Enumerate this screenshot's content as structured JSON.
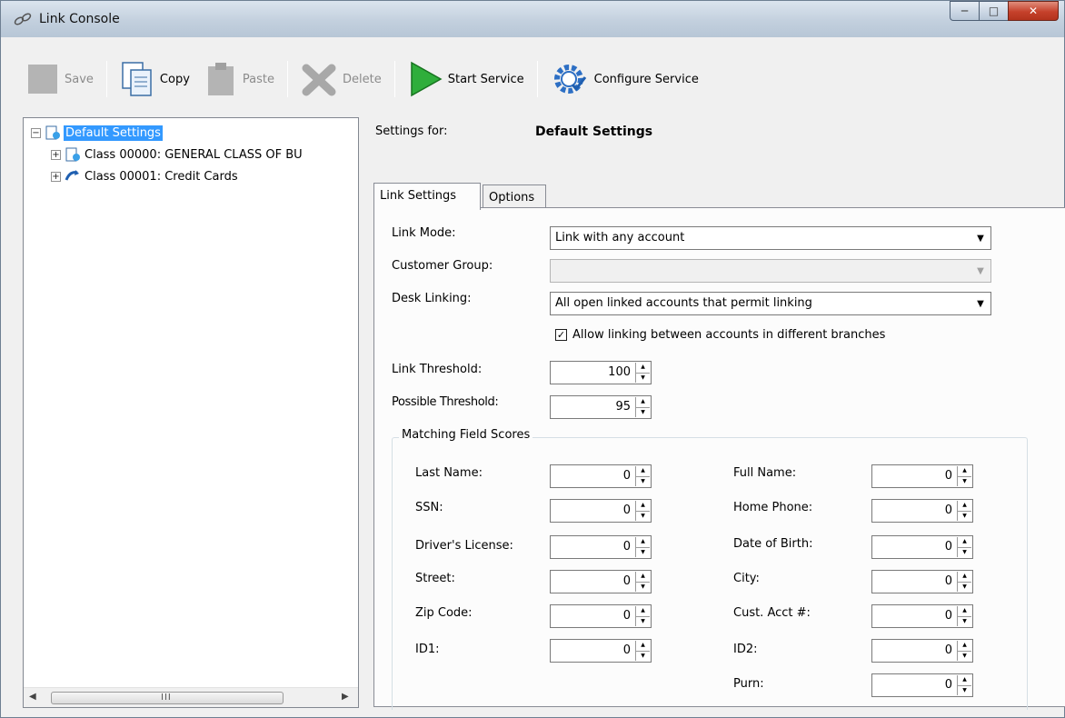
{
  "window": {
    "title": "Link Console"
  },
  "toolbar": {
    "save": "Save",
    "copy": "Copy",
    "paste": "Paste",
    "delete": "Delete",
    "start_service": "Start Service",
    "configure_service": "Configure Service"
  },
  "tree": {
    "root": "Default Settings",
    "items": [
      {
        "label": "Class 00000: GENERAL CLASS OF BU"
      },
      {
        "label": "Class 00001: Credit Cards"
      }
    ],
    "scroll_grip": "III"
  },
  "header": {
    "settings_for_label": "Settings for:",
    "settings_for_value": "Default Settings"
  },
  "tabs": [
    {
      "label": "Link Settings"
    },
    {
      "label": "Options"
    }
  ],
  "form": {
    "link_mode_label": "Link Mode:",
    "link_mode_value": "Link with any account",
    "customer_group_label": "Customer Group:",
    "customer_group_value": "",
    "desk_linking_label": "Desk Linking:",
    "desk_linking_value": "All open linked accounts that permit linking",
    "allow_linking_label": "Allow linking between accounts in different branches",
    "allow_linking_checked": true,
    "link_threshold_label": "Link Threshold:",
    "link_threshold_value": "100",
    "possible_threshold_label": "Possible Threshold:",
    "possible_threshold_value": "95"
  },
  "matching": {
    "title": "Matching Field Scores",
    "left": [
      {
        "label": "Last Name:",
        "value": "0"
      },
      {
        "label": "SSN:",
        "value": "0"
      },
      {
        "label": "Driver's License:",
        "value": "0"
      },
      {
        "label": "Street:",
        "value": "0"
      },
      {
        "label": "Zip Code:",
        "value": "0"
      },
      {
        "label": "ID1:",
        "value": "0"
      }
    ],
    "right": [
      {
        "label": "Full Name:",
        "value": "0"
      },
      {
        "label": "Home Phone:",
        "value": "0"
      },
      {
        "label": "Date of Birth:",
        "value": "0"
      },
      {
        "label": "City:",
        "value": "0"
      },
      {
        "label": "Cust. Acct #:",
        "value": "0"
      },
      {
        "label": "ID2:",
        "value": "0"
      },
      {
        "label": "Purn:",
        "value": "0"
      }
    ]
  }
}
